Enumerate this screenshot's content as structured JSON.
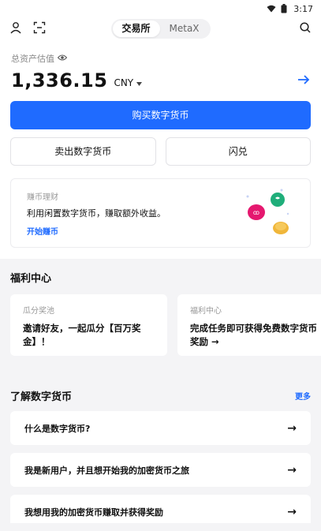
{
  "status_bar": {
    "time": "3:17"
  },
  "nav": {
    "tabs": [
      {
        "label": "交易所",
        "active": true
      },
      {
        "label": "MetaX",
        "active": false
      }
    ]
  },
  "asset": {
    "label": "总资产估值",
    "value": "1,336.15",
    "currency": "CNY"
  },
  "actions": {
    "buy": "购买数字货币",
    "sell": "卖出数字货币",
    "swap": "闪兑"
  },
  "earn": {
    "title": "赚币理财",
    "description": "利用闲置数字货币，赚取额外收益。",
    "link": "开始赚币"
  },
  "welfare": {
    "title": "福利中心",
    "cards": [
      {
        "tag": "瓜分奖池",
        "text": "邀请好友，一起瓜分【百万奖金】！"
      },
      {
        "tag": "福利中心",
        "text": "完成任务即可获得免费数字货币奖励 →"
      }
    ]
  },
  "learn": {
    "title": "了解数字货币",
    "more": "更多",
    "items": [
      {
        "label": "什么是数字货币?"
      },
      {
        "label": "我是新用户，并且想开始我的加密货币之旅"
      },
      {
        "label": "我想用我的加密货币赚取并获得奖励"
      }
    ]
  },
  "colors": {
    "accent": "#1f6bff",
    "background_section": "#f4f4f6"
  }
}
